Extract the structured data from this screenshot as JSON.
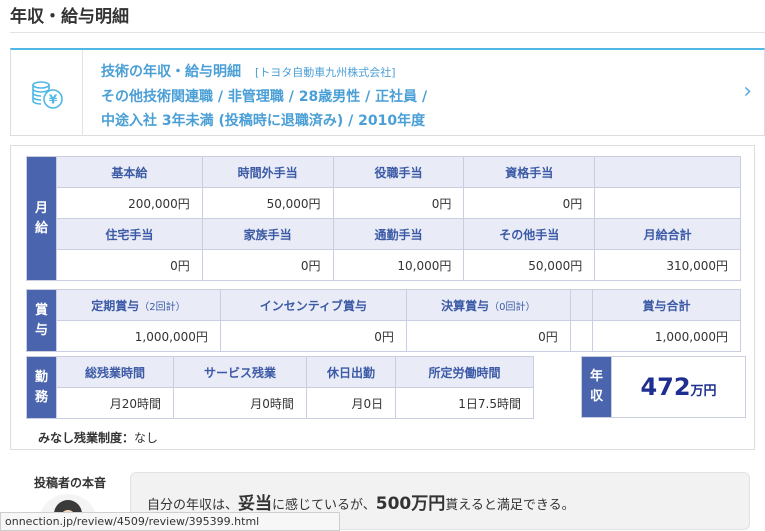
{
  "page": {
    "title": "年収・給与明細"
  },
  "card": {
    "line1": "技術の年収・給与明細",
    "company": "[トヨタ自動車九州株式会社]",
    "line2": "その他技術関連職 / 非管理職 / 28歳男性 / 正社員 /",
    "line3": "中途入社 3年未満 (投稿時に退職済み)  / 2010年度",
    "icon": "coins-yen-icon",
    "arrow": "chevron-right-icon"
  },
  "monthly": {
    "side": "月給",
    "row1_headers": [
      "基本給",
      "時間外手当",
      "役職手当",
      "資格手当",
      ""
    ],
    "row1_values": [
      "200,000円",
      "50,000円",
      "0円",
      "0円",
      ""
    ],
    "row2_headers": [
      "住宅手当",
      "家族手当",
      "通勤手当",
      "その他手当",
      "月給合計"
    ],
    "row2_values": [
      "0円",
      "0円",
      "10,000円",
      "50,000円",
      "310,000円"
    ]
  },
  "bonus": {
    "side": "賞与",
    "h1": "定期賞与",
    "h1_note": "（2回計）",
    "h2": "インセンティブ賞与",
    "h3": "決算賞与",
    "h3_note": "（0回計）",
    "h5": "賞与合計",
    "values": [
      "1,000,000円",
      "0円",
      "0円",
      "",
      "1,000,000円"
    ]
  },
  "work": {
    "side": "勤務",
    "headers": [
      "総残業時間",
      "サービス残業",
      "休日出勤",
      "所定労働時間"
    ],
    "values": [
      "月20時間",
      "月0時間",
      "月0日",
      "1日7.5時間"
    ]
  },
  "annual": {
    "side": "年収",
    "amount": "472",
    "unit": "万円"
  },
  "minashi": {
    "label": "みなし残業制度：",
    "value": "なし"
  },
  "honne": {
    "label": "投稿者の本音",
    "t1": "自分の年収は、",
    "t2": "妥当",
    "t3": "に感じているが、",
    "t4": "500万円",
    "t5": "貰えると満足できる。"
  },
  "status_bar": {
    "url": "onnection.jp/review/4509/review/395399.html"
  },
  "colors": {
    "accent": "#4fb8e6",
    "table_side": "#4a64ad",
    "header_bg": "#e9ecf6",
    "amount": "#1e2f8f"
  }
}
